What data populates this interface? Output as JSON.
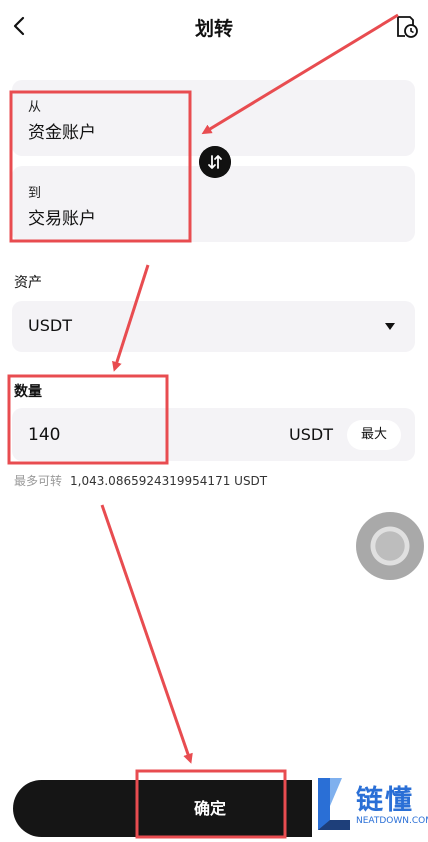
{
  "header": {
    "title": "划转",
    "back_icon": "chevron-left-icon",
    "history_icon": "history-icon"
  },
  "transfer": {
    "from_label": "从",
    "from_value": "资金账户",
    "to_label": "到",
    "to_value": "交易账户",
    "swap_icon": "swap-arrows-icon"
  },
  "asset": {
    "label": "资产",
    "value": "USDT"
  },
  "quantity": {
    "label": "数量",
    "value": "140",
    "unit": "USDT",
    "max_label": "最大",
    "available_label": "最多可转",
    "available_value": "1,043.0865924319954171 USDT"
  },
  "confirm_label": "确定",
  "watermark": {
    "text": "链懂",
    "sub": "NEATDOWN.COM"
  },
  "colors": {
    "annotation": "#e84c50",
    "button": "#151515",
    "card": "#f4f3f6",
    "watermark": "#2a6fd6"
  }
}
